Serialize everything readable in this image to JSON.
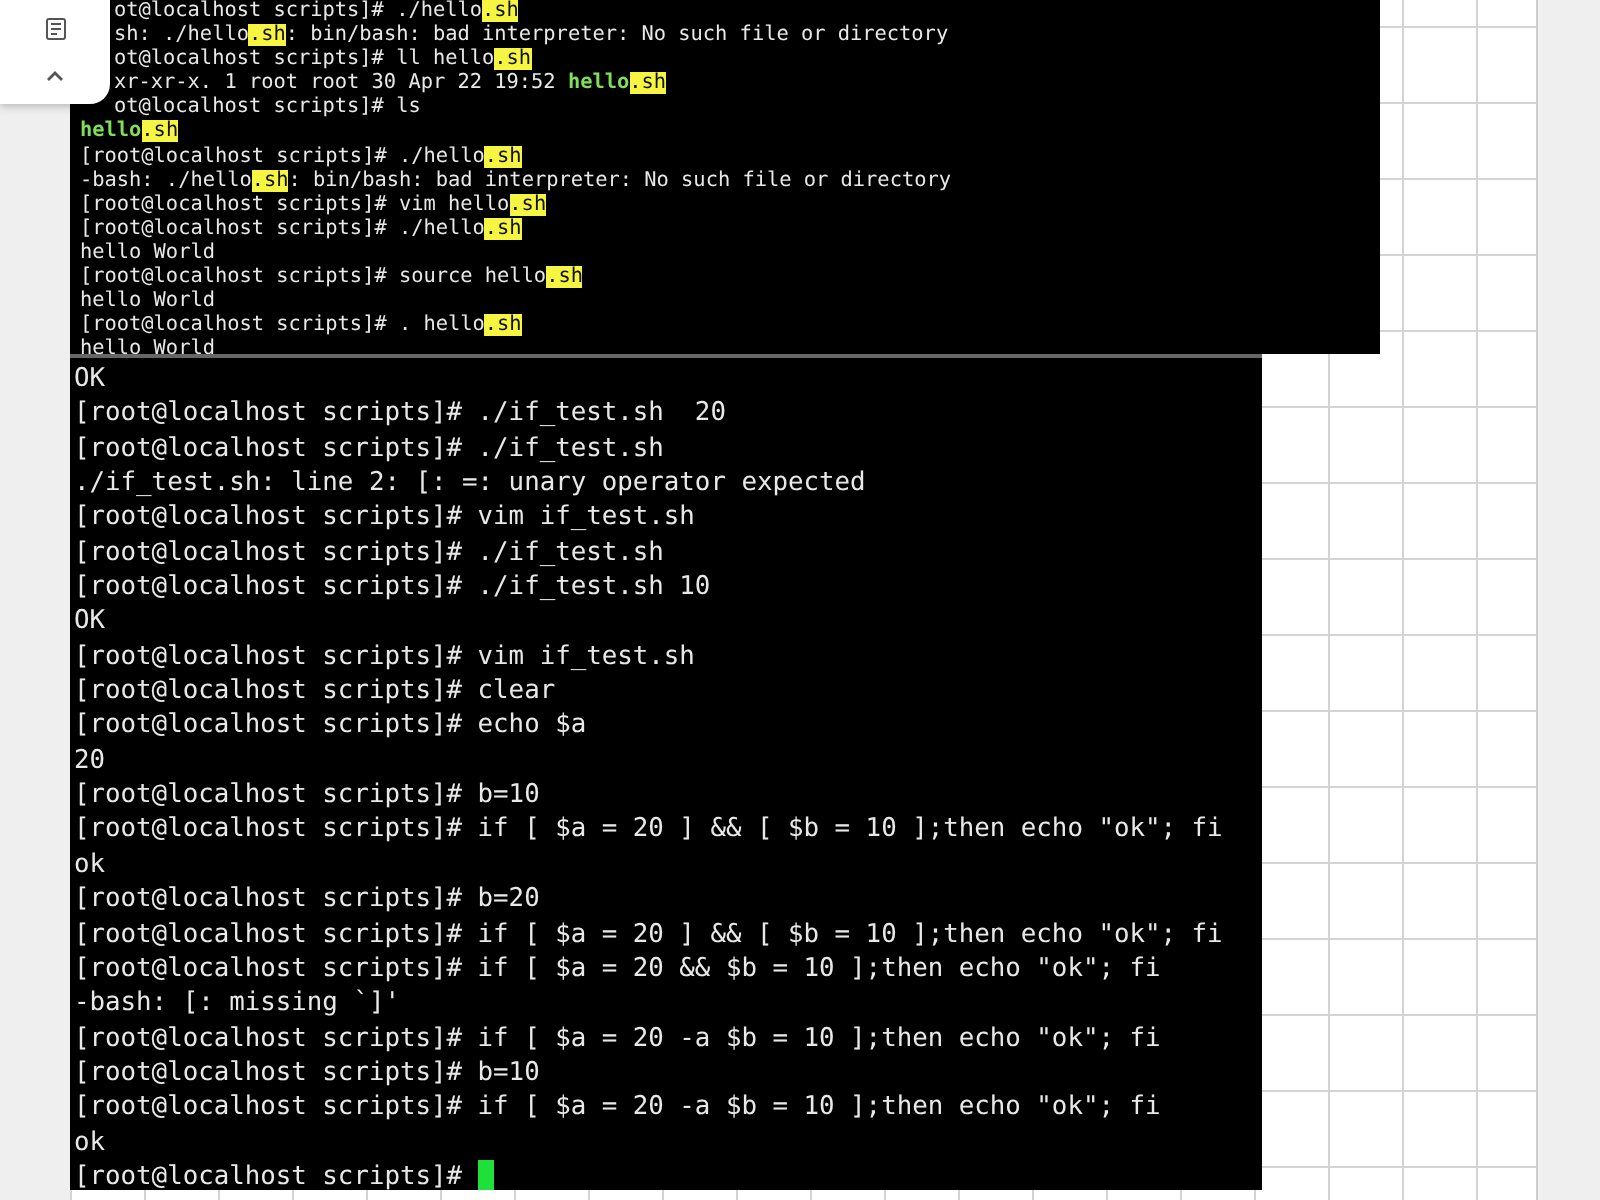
{
  "side_panel": {
    "buttons": [
      {
        "kind": "document"
      },
      {
        "kind": "collapse"
      }
    ]
  },
  "terminals": [
    {
      "clipped_lines": [
        {
          "parts": [
            {
              "kind": "plain",
              "text": "ot@localhost scripts]# ./hello"
            },
            {
              "kind": "match",
              "text": ".sh"
            }
          ]
        },
        {
          "parts": [
            {
              "kind": "plain",
              "text": "sh: ./hello"
            },
            {
              "kind": "match",
              "text": ".sh"
            },
            {
              "kind": "plain",
              "text": ": bin/bash: bad interpreter: No such file or directory"
            }
          ]
        },
        {
          "parts": [
            {
              "kind": "plain",
              "text": "ot@localhost scripts]# ll hello"
            },
            {
              "kind": "match",
              "text": ".sh"
            }
          ]
        },
        {
          "parts": [
            {
              "kind": "plain",
              "text": "xr-xr-x. 1 root root 30 Apr 22 19:52 "
            },
            {
              "kind": "exec",
              "text": "hello"
            },
            {
              "kind": "match",
              "text": ".sh"
            }
          ]
        },
        {
          "parts": [
            {
              "kind": "plain",
              "text": "ot@localhost scripts]# ls"
            }
          ]
        }
      ],
      "lines": [
        {
          "parts": [
            {
              "kind": "exec",
              "text": "hello"
            },
            {
              "kind": "match",
              "text": ".sh"
            }
          ]
        },
        {
          "parts": [
            {
              "kind": "plain",
              "text": "[root@localhost scripts]# ./hello"
            },
            {
              "kind": "match",
              "text": ".sh"
            }
          ]
        },
        {
          "parts": [
            {
              "kind": "plain",
              "text": "-bash: ./hello"
            },
            {
              "kind": "match",
              "text": ".sh"
            },
            {
              "kind": "plain",
              "text": ": bin/bash: bad interpreter: No such file or directory"
            }
          ]
        },
        {
          "parts": [
            {
              "kind": "plain",
              "text": "[root@localhost scripts]# vim hello"
            },
            {
              "kind": "match",
              "text": ".sh"
            }
          ]
        },
        {
          "parts": [
            {
              "kind": "plain",
              "text": "[root@localhost scripts]# ./hello"
            },
            {
              "kind": "match",
              "text": ".sh"
            }
          ]
        },
        {
          "parts": [
            {
              "kind": "plain",
              "text": "hello World"
            }
          ]
        },
        {
          "parts": [
            {
              "kind": "plain",
              "text": "[root@localhost scripts]# source hello"
            },
            {
              "kind": "match",
              "text": ".sh"
            }
          ]
        },
        {
          "parts": [
            {
              "kind": "plain",
              "text": "hello World"
            }
          ]
        },
        {
          "parts": [
            {
              "kind": "plain",
              "text": "[root@localhost scripts]# . hello"
            },
            {
              "kind": "match",
              "text": ".sh"
            }
          ]
        },
        {
          "parts": [
            {
              "kind": "plain",
              "text": "hello World"
            }
          ]
        }
      ]
    },
    {
      "cursor": true,
      "lines": [
        {
          "parts": [
            {
              "kind": "plain",
              "text": "OK"
            }
          ]
        },
        {
          "parts": [
            {
              "kind": "plain",
              "text": "[root@localhost scripts]# ./if_test.sh  20"
            }
          ]
        },
        {
          "parts": [
            {
              "kind": "plain",
              "text": "[root@localhost scripts]# ./if_test.sh"
            }
          ]
        },
        {
          "parts": [
            {
              "kind": "plain",
              "text": "./if_test.sh: line 2: [: =: unary operator expected"
            }
          ]
        },
        {
          "parts": [
            {
              "kind": "plain",
              "text": "[root@localhost scripts]# vim if_test.sh"
            }
          ]
        },
        {
          "parts": [
            {
              "kind": "plain",
              "text": "[root@localhost scripts]# ./if_test.sh"
            }
          ]
        },
        {
          "parts": [
            {
              "kind": "plain",
              "text": "[root@localhost scripts]# ./if_test.sh 10"
            }
          ]
        },
        {
          "parts": [
            {
              "kind": "plain",
              "text": "OK"
            }
          ]
        },
        {
          "parts": [
            {
              "kind": "plain",
              "text": "[root@localhost scripts]# vim if_test.sh"
            }
          ]
        },
        {
          "parts": [
            {
              "kind": "plain",
              "text": "[root@localhost scripts]# clear"
            }
          ]
        },
        {
          "parts": [
            {
              "kind": "plain",
              "text": "[root@localhost scripts]# echo $a"
            }
          ]
        },
        {
          "parts": [
            {
              "kind": "plain",
              "text": "20"
            }
          ]
        },
        {
          "parts": [
            {
              "kind": "plain",
              "text": "[root@localhost scripts]# b=10"
            }
          ]
        },
        {
          "parts": [
            {
              "kind": "plain",
              "text": "[root@localhost scripts]# if [ $a = 20 ] && [ $b = 10 ];then echo \"ok\"; fi"
            }
          ]
        },
        {
          "parts": [
            {
              "kind": "plain",
              "text": "ok"
            }
          ]
        },
        {
          "parts": [
            {
              "kind": "plain",
              "text": "[root@localhost scripts]# b=20"
            }
          ]
        },
        {
          "parts": [
            {
              "kind": "plain",
              "text": "[root@localhost scripts]# if [ $a = 20 ] && [ $b = 10 ];then echo \"ok\"; fi"
            }
          ]
        },
        {
          "parts": [
            {
              "kind": "plain",
              "text": "[root@localhost scripts]# if [ $a = 20 && $b = 10 ];then echo \"ok\"; fi"
            }
          ]
        },
        {
          "parts": [
            {
              "kind": "plain",
              "text": "-bash: [: missing `]'"
            }
          ]
        },
        {
          "parts": [
            {
              "kind": "plain",
              "text": "[root@localhost scripts]# if [ $a = 20 -a $b = 10 ];then echo \"ok\"; fi"
            }
          ]
        },
        {
          "parts": [
            {
              "kind": "plain",
              "text": "[root@localhost scripts]# b=10"
            }
          ]
        },
        {
          "parts": [
            {
              "kind": "plain",
              "text": "[root@localhost scripts]# if [ $a = 20 -a $b = 10 ];then echo \"ok\"; fi"
            }
          ]
        },
        {
          "parts": [
            {
              "kind": "plain",
              "text": "ok"
            }
          ]
        },
        {
          "parts": [
            {
              "kind": "plain",
              "text": "[root@localhost scripts]# "
            }
          ]
        }
      ]
    }
  ]
}
